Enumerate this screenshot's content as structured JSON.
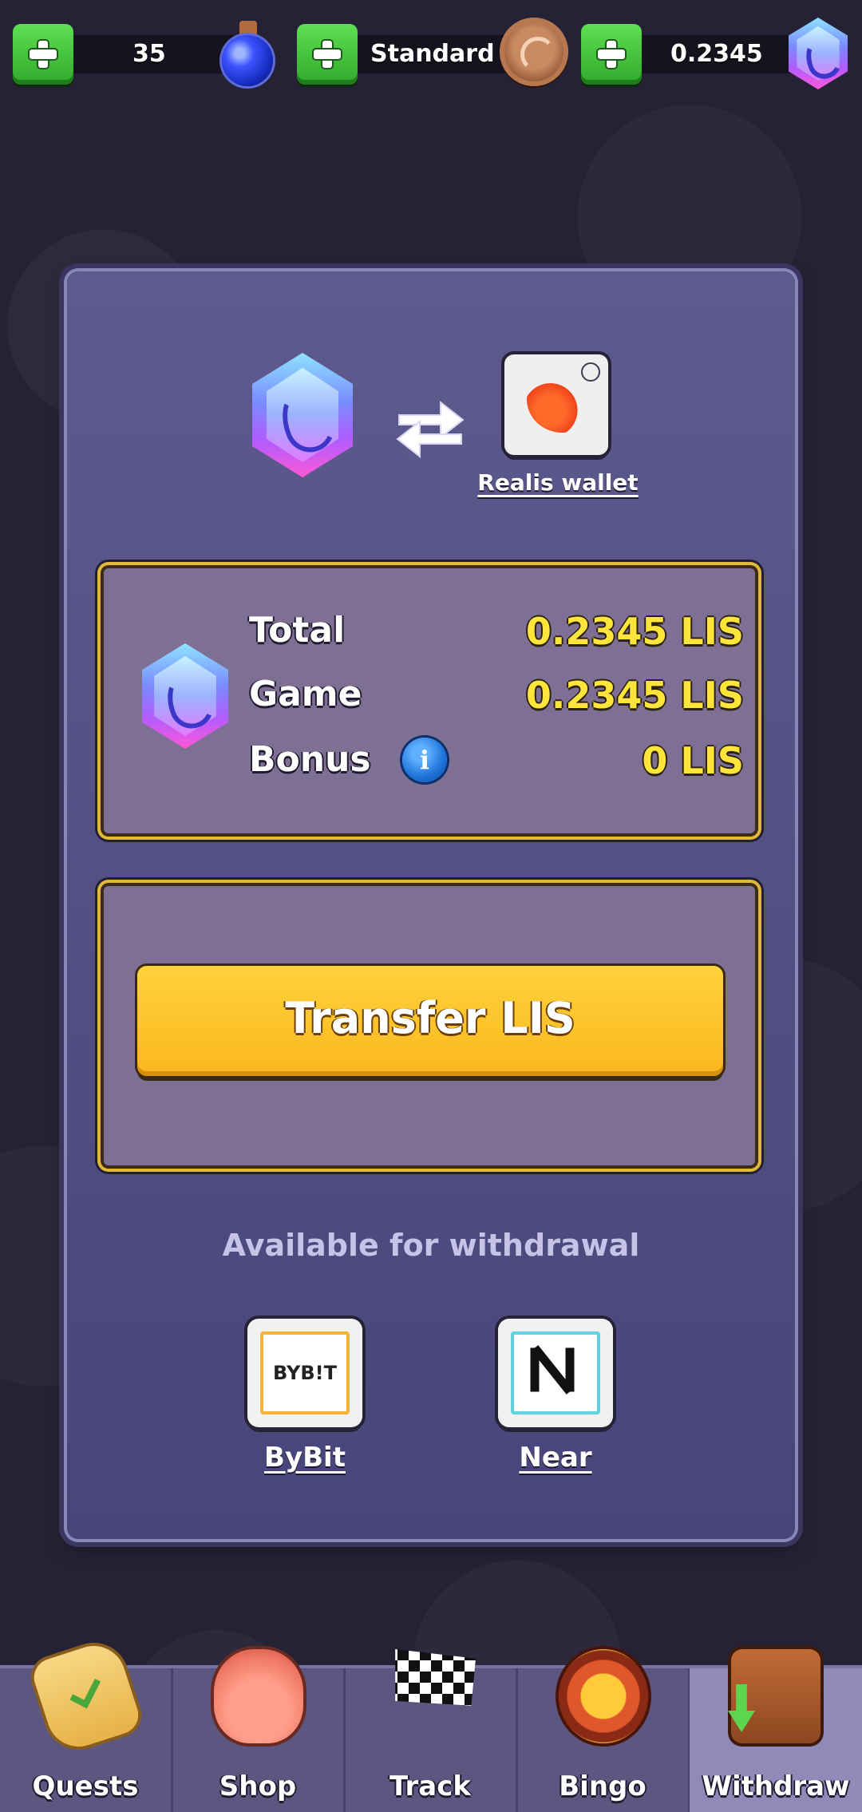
{
  "topbar": {
    "potions": {
      "value": "35",
      "icon": "potion-icon"
    },
    "league": {
      "value": "Standard",
      "icon": "bronze-medal-icon"
    },
    "lis": {
      "value": "0.2345",
      "icon": "lis-gem-icon"
    }
  },
  "wallet": {
    "link_label": "Realis wallet",
    "swap_icon": "swap-arrows-icon"
  },
  "balance": {
    "total_label": "Total",
    "total_value": "0.2345 LIS",
    "game_label": "Game",
    "game_value": "0.2345 LIS",
    "bonus_label": "Bonus",
    "bonus_value": "0 LIS",
    "info_glyph": "i"
  },
  "transfer": {
    "button_label": "Transfer LIS"
  },
  "withdrawal": {
    "heading": "Available for withdrawal",
    "exchanges": [
      {
        "label": "ByBit",
        "logo_text": "BYB!T"
      },
      {
        "label": "Near"
      }
    ]
  },
  "nav": {
    "items": [
      {
        "label": "Quests",
        "icon": "quest-scroll-icon"
      },
      {
        "label": "Shop",
        "icon": "shop-bag-icon"
      },
      {
        "label": "Track",
        "icon": "checkered-flag-icon"
      },
      {
        "label": "Bingo",
        "icon": "bingo-icon"
      },
      {
        "label": "Withdraw",
        "icon": "wallet-icon",
        "active": true
      }
    ]
  },
  "colors": {
    "background": "#262236",
    "panel": "#5e5a8e",
    "card": "#7e7095",
    "gold_border": "#e0b83c",
    "amount_yellow": "#ffe53a",
    "button_yellow": "#fbb71d",
    "plus_green": "#2fa82b"
  }
}
